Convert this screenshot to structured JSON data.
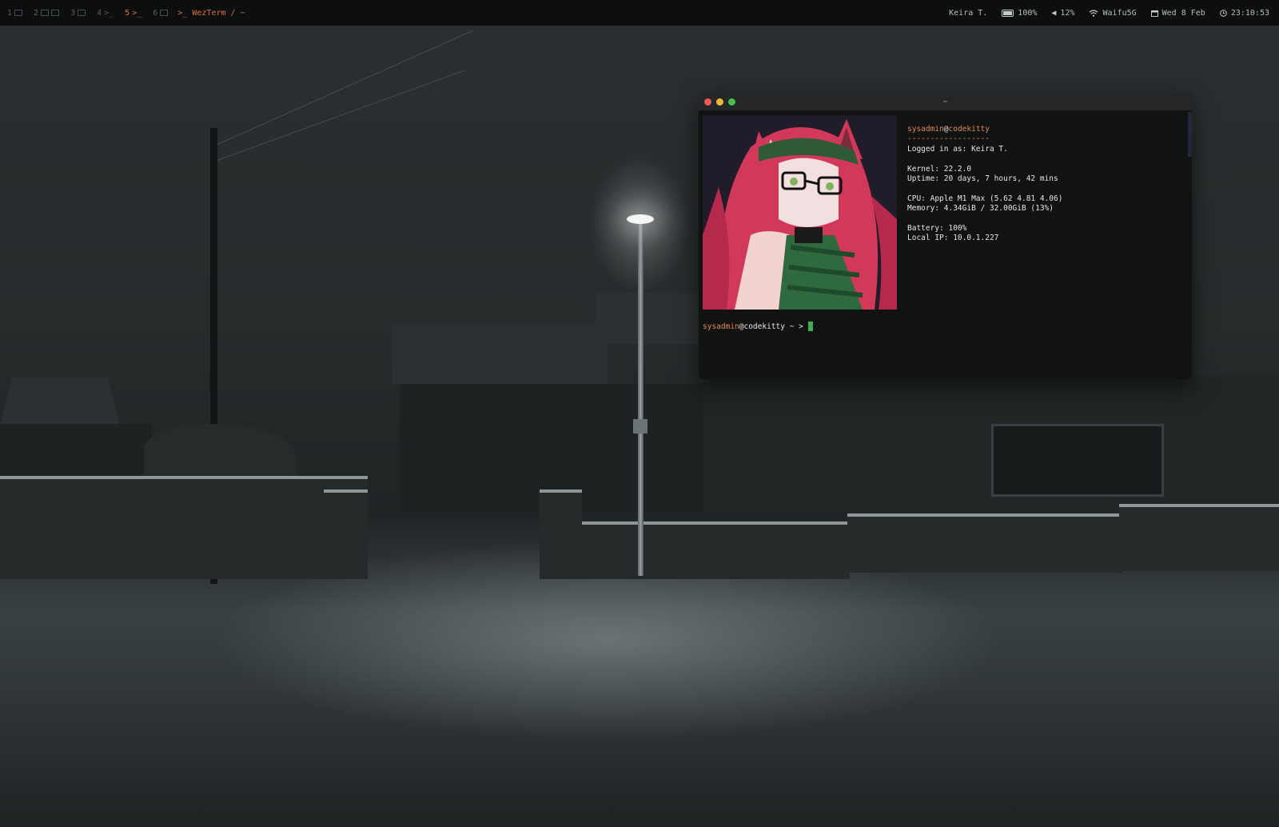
{
  "topbar": {
    "workspaces": [
      {
        "number": "1",
        "icon": "window-icon",
        "active": false
      },
      {
        "number": "2",
        "icon": "window-icon",
        "active": false
      },
      {
        "number": "3",
        "icon": "window-icon",
        "active": false
      },
      {
        "number": "4",
        "icon": "terminal-icon",
        "active": false
      },
      {
        "number": "5",
        "icon": "terminal-icon",
        "active": true
      },
      {
        "number": "6",
        "icon": "window-icon",
        "active": false
      }
    ],
    "active_window_title": "WezTerm / ~",
    "user": "Keira T.",
    "battery": "100%",
    "volume": "12%",
    "wifi": "Waifu5G",
    "date": "Wed 8 Feb",
    "time": "23:10:53"
  },
  "terminal": {
    "title": "~",
    "header_user": "sysadmin",
    "header_at": "@",
    "header_host": "codekitty",
    "separator": "------------------",
    "logged_in": "Logged in as: Keira T.",
    "kernel": "Kernel: 22.2.0",
    "uptime": "Uptime: 20 days, 7 hours, 42 mins",
    "cpu": "CPU: Apple M1 Max (5.62 4.81 4.06)",
    "memory": "Memory: 4.34GiB / 32.00GiB (13%)",
    "battery": "Battery: 100%",
    "local_ip": "Local IP: 10.0.1.227",
    "prompt_user": "sysadmin",
    "prompt_host": "@codekitty",
    "prompt_symbol": " ~ >"
  },
  "colors": {
    "accent": "#e0703a",
    "user_color": "#e08a54",
    "cursor": "#3fae55",
    "close": "#ee5b52",
    "minimize": "#e6b93b",
    "maximize": "#49c04d"
  }
}
